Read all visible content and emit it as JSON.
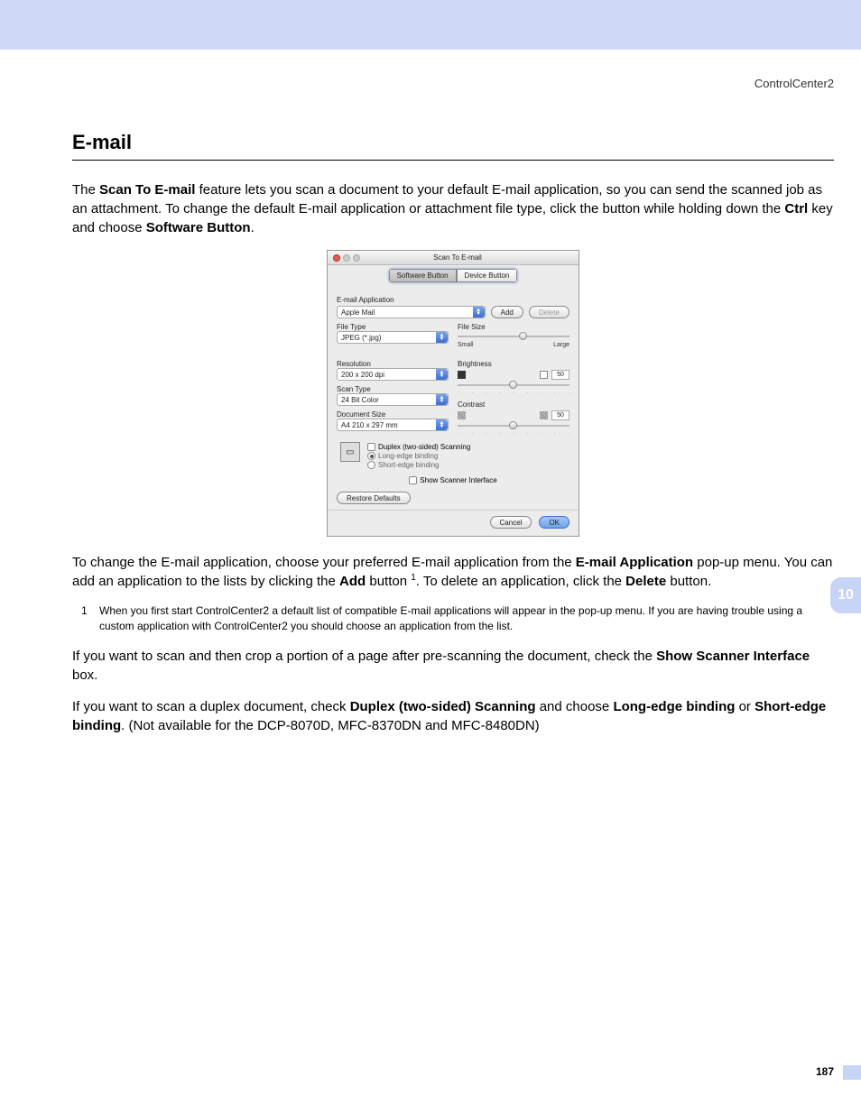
{
  "header": {
    "product": "ControlCenter2"
  },
  "section": {
    "title": "E-mail"
  },
  "para1": {
    "t1": "The ",
    "b1": "Scan To E-mail",
    "t2": " feature lets you scan a document to your default E-mail application, so you can send the scanned job as an attachment. To change the default E-mail application or attachment file type, click the button while holding down the ",
    "b2": "Ctrl",
    "t3": " key and choose ",
    "b3": "Software Button",
    "t4": "."
  },
  "para2": {
    "t1": "To change the E-mail application, choose your preferred E-mail application from the ",
    "b1": "E-mail Application",
    "t2": " pop-up menu. You can add an application to the lists by clicking the ",
    "b2": "Add",
    "t3": " button ",
    "sup": "1",
    "t4": ". To delete an application, click the ",
    "b3": "Delete",
    "t5": " button."
  },
  "footnote": {
    "num": "1",
    "text": "When you first start ControlCenter2 a default list of compatible E-mail applications will appear in the pop-up menu. If you are having trouble using a custom application with ControlCenter2 you should choose an application from the list."
  },
  "para3": {
    "t1": "If you want to scan and then crop a portion of a page after pre-scanning the document, check the ",
    "b1": "Show Scanner Interface",
    "t2": " box."
  },
  "para4": {
    "t1": "If you want to scan a duplex document, check ",
    "b1": "Duplex (two-sided) Scanning",
    "t2": " and choose ",
    "b2": "Long-edge binding",
    "t3": " or ",
    "b3": "Short-edge binding",
    "t4": ". (Not available for the DCP-8070D, MFC-8370DN and MFC-8480DN)"
  },
  "dialog": {
    "title": "Scan To E-mail",
    "tabs": {
      "software": "Software Button",
      "device": "Device Button"
    },
    "labels": {
      "emailApp": "E-mail Application",
      "fileType": "File Type",
      "fileSize": "File Size",
      "small": "Small",
      "large": "Large",
      "resolution": "Resolution",
      "scanType": "Scan Type",
      "docSize": "Document Size",
      "brightness": "Brightness",
      "contrast": "Contrast",
      "duplex": "Duplex (two-sided) Scanning",
      "longEdge": "Long-edge binding",
      "shortEdge": "Short-edge binding",
      "showScanner": "Show Scanner Interface"
    },
    "values": {
      "emailApp": "Apple Mail",
      "fileType": "JPEG (*.jpg)",
      "resolution": "200 x 200 dpi",
      "scanType": "24 Bit Color",
      "docSize": "A4  210 x 297 mm",
      "brightness": "50",
      "contrast": "50"
    },
    "buttons": {
      "add": "Add",
      "delete": "Delete",
      "restore": "Restore Defaults",
      "cancel": "Cancel",
      "ok": "OK"
    }
  },
  "side": {
    "chapter": "10",
    "page": "187"
  }
}
